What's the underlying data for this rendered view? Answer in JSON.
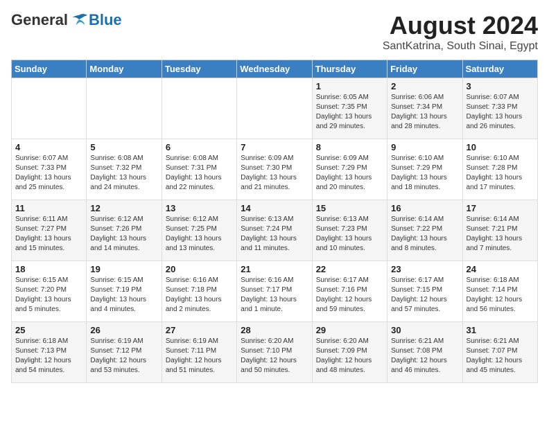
{
  "logo": {
    "general": "General",
    "blue": "Blue"
  },
  "title": {
    "month_year": "August 2024",
    "location": "SantKatrina, South Sinai, Egypt"
  },
  "days_of_week": [
    "Sunday",
    "Monday",
    "Tuesday",
    "Wednesday",
    "Thursday",
    "Friday",
    "Saturday"
  ],
  "weeks": [
    [
      {
        "day": "",
        "info": ""
      },
      {
        "day": "",
        "info": ""
      },
      {
        "day": "",
        "info": ""
      },
      {
        "day": "",
        "info": ""
      },
      {
        "day": "1",
        "info": "Sunrise: 6:05 AM\nSunset: 7:35 PM\nDaylight: 13 hours\nand 29 minutes."
      },
      {
        "day": "2",
        "info": "Sunrise: 6:06 AM\nSunset: 7:34 PM\nDaylight: 13 hours\nand 28 minutes."
      },
      {
        "day": "3",
        "info": "Sunrise: 6:07 AM\nSunset: 7:33 PM\nDaylight: 13 hours\nand 26 minutes."
      }
    ],
    [
      {
        "day": "4",
        "info": "Sunrise: 6:07 AM\nSunset: 7:33 PM\nDaylight: 13 hours\nand 25 minutes."
      },
      {
        "day": "5",
        "info": "Sunrise: 6:08 AM\nSunset: 7:32 PM\nDaylight: 13 hours\nand 24 minutes."
      },
      {
        "day": "6",
        "info": "Sunrise: 6:08 AM\nSunset: 7:31 PM\nDaylight: 13 hours\nand 22 minutes."
      },
      {
        "day": "7",
        "info": "Sunrise: 6:09 AM\nSunset: 7:30 PM\nDaylight: 13 hours\nand 21 minutes."
      },
      {
        "day": "8",
        "info": "Sunrise: 6:09 AM\nSunset: 7:29 PM\nDaylight: 13 hours\nand 20 minutes."
      },
      {
        "day": "9",
        "info": "Sunrise: 6:10 AM\nSunset: 7:29 PM\nDaylight: 13 hours\nand 18 minutes."
      },
      {
        "day": "10",
        "info": "Sunrise: 6:10 AM\nSunset: 7:28 PM\nDaylight: 13 hours\nand 17 minutes."
      }
    ],
    [
      {
        "day": "11",
        "info": "Sunrise: 6:11 AM\nSunset: 7:27 PM\nDaylight: 13 hours\nand 15 minutes."
      },
      {
        "day": "12",
        "info": "Sunrise: 6:12 AM\nSunset: 7:26 PM\nDaylight: 13 hours\nand 14 minutes."
      },
      {
        "day": "13",
        "info": "Sunrise: 6:12 AM\nSunset: 7:25 PM\nDaylight: 13 hours\nand 13 minutes."
      },
      {
        "day": "14",
        "info": "Sunrise: 6:13 AM\nSunset: 7:24 PM\nDaylight: 13 hours\nand 11 minutes."
      },
      {
        "day": "15",
        "info": "Sunrise: 6:13 AM\nSunset: 7:23 PM\nDaylight: 13 hours\nand 10 minutes."
      },
      {
        "day": "16",
        "info": "Sunrise: 6:14 AM\nSunset: 7:22 PM\nDaylight: 13 hours\nand 8 minutes."
      },
      {
        "day": "17",
        "info": "Sunrise: 6:14 AM\nSunset: 7:21 PM\nDaylight: 13 hours\nand 7 minutes."
      }
    ],
    [
      {
        "day": "18",
        "info": "Sunrise: 6:15 AM\nSunset: 7:20 PM\nDaylight: 13 hours\nand 5 minutes."
      },
      {
        "day": "19",
        "info": "Sunrise: 6:15 AM\nSunset: 7:19 PM\nDaylight: 13 hours\nand 4 minutes."
      },
      {
        "day": "20",
        "info": "Sunrise: 6:16 AM\nSunset: 7:18 PM\nDaylight: 13 hours\nand 2 minutes."
      },
      {
        "day": "21",
        "info": "Sunrise: 6:16 AM\nSunset: 7:17 PM\nDaylight: 13 hours\nand 1 minute."
      },
      {
        "day": "22",
        "info": "Sunrise: 6:17 AM\nSunset: 7:16 PM\nDaylight: 12 hours\nand 59 minutes."
      },
      {
        "day": "23",
        "info": "Sunrise: 6:17 AM\nSunset: 7:15 PM\nDaylight: 12 hours\nand 57 minutes."
      },
      {
        "day": "24",
        "info": "Sunrise: 6:18 AM\nSunset: 7:14 PM\nDaylight: 12 hours\nand 56 minutes."
      }
    ],
    [
      {
        "day": "25",
        "info": "Sunrise: 6:18 AM\nSunset: 7:13 PM\nDaylight: 12 hours\nand 54 minutes."
      },
      {
        "day": "26",
        "info": "Sunrise: 6:19 AM\nSunset: 7:12 PM\nDaylight: 12 hours\nand 53 minutes."
      },
      {
        "day": "27",
        "info": "Sunrise: 6:19 AM\nSunset: 7:11 PM\nDaylight: 12 hours\nand 51 minutes."
      },
      {
        "day": "28",
        "info": "Sunrise: 6:20 AM\nSunset: 7:10 PM\nDaylight: 12 hours\nand 50 minutes."
      },
      {
        "day": "29",
        "info": "Sunrise: 6:20 AM\nSunset: 7:09 PM\nDaylight: 12 hours\nand 48 minutes."
      },
      {
        "day": "30",
        "info": "Sunrise: 6:21 AM\nSunset: 7:08 PM\nDaylight: 12 hours\nand 46 minutes."
      },
      {
        "day": "31",
        "info": "Sunrise: 6:21 AM\nSunset: 7:07 PM\nDaylight: 12 hours\nand 45 minutes."
      }
    ]
  ]
}
